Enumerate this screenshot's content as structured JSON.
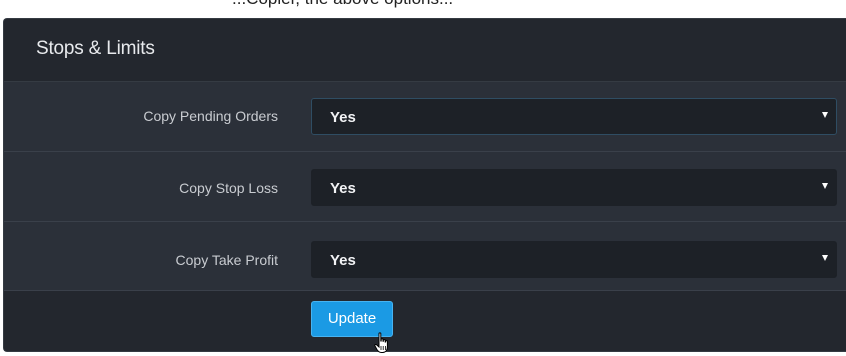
{
  "top_strip": {
    "partial_text": "...Copier, the above options..."
  },
  "panel": {
    "title": "Stops & Limits",
    "rows": [
      {
        "label": "Copy Pending Orders",
        "value": "Yes",
        "focused": true
      },
      {
        "label": "Copy Stop Loss",
        "value": "Yes",
        "focused": false
      },
      {
        "label": "Copy Take Profit",
        "value": "Yes",
        "focused": false
      }
    ],
    "update_label": "Update"
  },
  "colors": {
    "panel_bg": "#1f2329",
    "row_bg": "#2b3039",
    "select_bg": "#1d2127",
    "button_bg": "#1b9ae4"
  },
  "icons": {
    "caret": "chevron-down-icon",
    "cursor": "hand-pointer-icon"
  }
}
